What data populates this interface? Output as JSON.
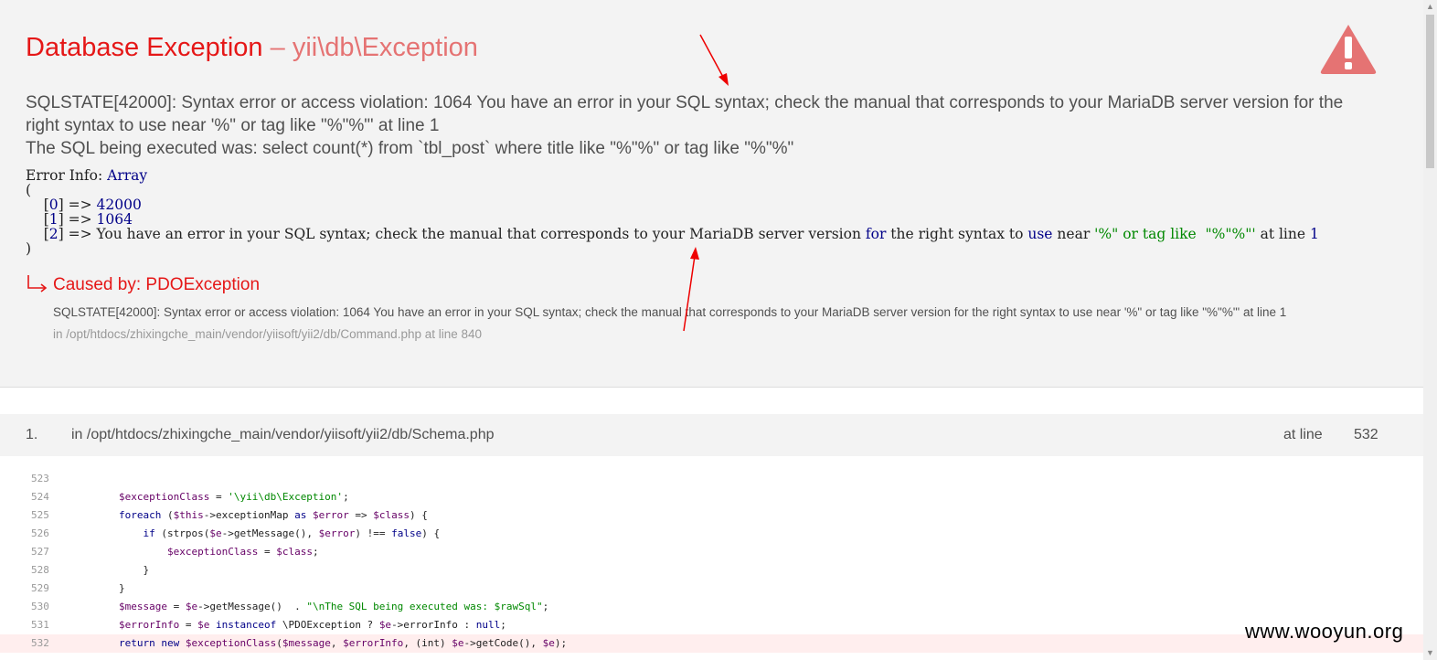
{
  "header": {
    "title_main": "Database Exception",
    "title_sep": " – ",
    "title_class": "yii\\db\\Exception",
    "message_line1": "SQLSTATE[42000]: Syntax error or access violation: 1064 You have an error in your SQL syntax; check the manual that corresponds to your MariaDB server version for the right syntax to use near '%\" or tag like \"%\"%\"' at line 1",
    "message_line2": "The SQL being executed was: select count(*) from `tbl_post` where title like \"%\"%\" or tag like \"%\"%\""
  },
  "error_info": {
    "label": "Error Info: ",
    "type": "Array",
    "open": "(",
    "close": ")",
    "items": [
      {
        "index": "0",
        "value": "42000"
      },
      {
        "index": "1",
        "value": "1064"
      }
    ],
    "item2_index": "2",
    "item2_p1": "You have an error in your SQL syntax; check the manual that corresponds to your MariaDB server version ",
    "item2_for": "for",
    "item2_p2": " the right syntax to ",
    "item2_use": "use",
    "item2_p3": " near ",
    "item2_str": "'%\" or tag like  \"%\"%\"'",
    "item2_p4": " at line ",
    "item2_num": "1"
  },
  "caused_by": {
    "title": "Caused by: PDOException",
    "message": "SQLSTATE[42000]: Syntax error or access violation: 1064 You have an error in your SQL syntax; check the manual that corresponds to your MariaDB server version for the right syntax to use near '%\" or tag like \"%\"%\"' at line 1",
    "file": "in /opt/htdocs/zhixingche_main/vendor/yiisoft/yii2/db/Command.php at line 840"
  },
  "trace": {
    "number": "1.",
    "file": "in /opt/htdocs/zhixingche_main/vendor/yiisoft/yii2/db/Schema.php",
    "at_line_label": "at line",
    "line": "532"
  },
  "code_lines": {
    "n523": "523",
    "n524": "524",
    "n525": "525",
    "n526": "526",
    "n527": "527",
    "n528": "528",
    "n529": "529",
    "n530": "530",
    "n531": "531",
    "n532": "532"
  },
  "colors": {
    "error_red": "#e51717",
    "class_red": "#e57373",
    "header_bg": "#f3f3f3",
    "highlight_bg": "#ffeeee"
  },
  "icons": {
    "warning": "warning-triangle-icon",
    "caused_arrow": "return-arrow-icon"
  },
  "watermark": "www.wooyun.org"
}
